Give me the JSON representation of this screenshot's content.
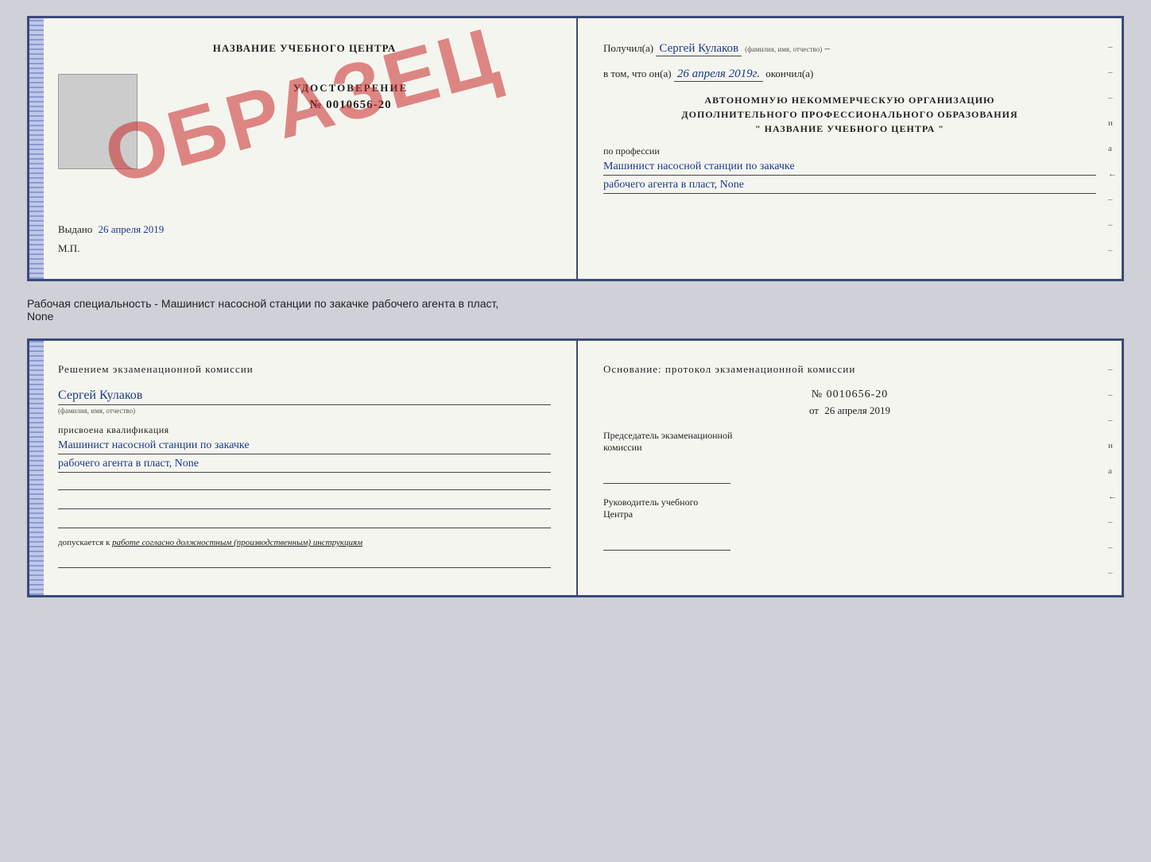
{
  "top_spread": {
    "left": {
      "title": "НАЗВАНИЕ УЧЕБНОГО ЦЕНТРА",
      "watermark": "ОБРАЗЕЦ",
      "cert_label": "УДОСТОВЕРЕНИЕ",
      "cert_number": "№ 0010656-20",
      "issued_label": "Выдано",
      "issued_date": "26 апреля 2019",
      "mp_label": "М.П."
    },
    "right": {
      "received_label": "Получил(а)",
      "received_name": "Сергей Кулаков",
      "name_hint": "(фамилия, имя, отчество)",
      "in_that_label": "в том, что он(а)",
      "date": "26 апреля 2019г.",
      "finished_label": "окончил(а)",
      "org_line1": "АВТОНОМНУЮ НЕКОММЕРЧЕСКУЮ ОРГАНИЗАЦИЮ",
      "org_line2": "ДОПОЛНИТЕЛЬНОГО ПРОФЕССИОНАЛЬНОГО ОБРАЗОВАНИЯ",
      "org_line3": "\"  НАЗВАНИЕ УЧЕБНОГО ЦЕНТРА  \"",
      "profession_label": "по профессии",
      "profession_line1": "Машинист насосной станции по закачке",
      "profession_line2": "рабочего агента в пласт, None",
      "dashes": [
        "-",
        "-",
        "–",
        "и",
        "а",
        "←",
        "-",
        "-",
        "-"
      ]
    }
  },
  "caption": {
    "text": "Рабочая специальность - Машинист насосной станции по закачке рабочего агента в пласт,",
    "text2": "None"
  },
  "bottom_spread": {
    "left": {
      "decision_label": "Решением экзаменационной комиссии",
      "person_name": "Сергей Кулаков",
      "name_hint": "(фамилия, имя, отчество)",
      "qualification_label": "присвоена квалификация",
      "qualification_line1": "Машинист насосной станции по закачке",
      "qualification_line2": "рабочего агента в пласт, None",
      "blank_lines": [
        "",
        "",
        ""
      ],
      "allows_label": "допускается к",
      "allows_text": "работе согласно должностным (производственным) инструкциям",
      "bottom_line": ""
    },
    "right": {
      "basis_label": "Основание: протокол экзаменационной комиссии",
      "protocol_number": "№ 0010656-20",
      "protocol_date_prefix": "от",
      "protocol_date": "26 апреля 2019",
      "chairman_label": "Председатель экзаменационной",
      "chairman_label2": "комиссии",
      "head_label": "Руководитель учебного",
      "head_label2": "Центра",
      "dashes": [
        "-",
        "-",
        "–",
        "и",
        "а",
        "←",
        "-",
        "-",
        "-"
      ]
    }
  }
}
